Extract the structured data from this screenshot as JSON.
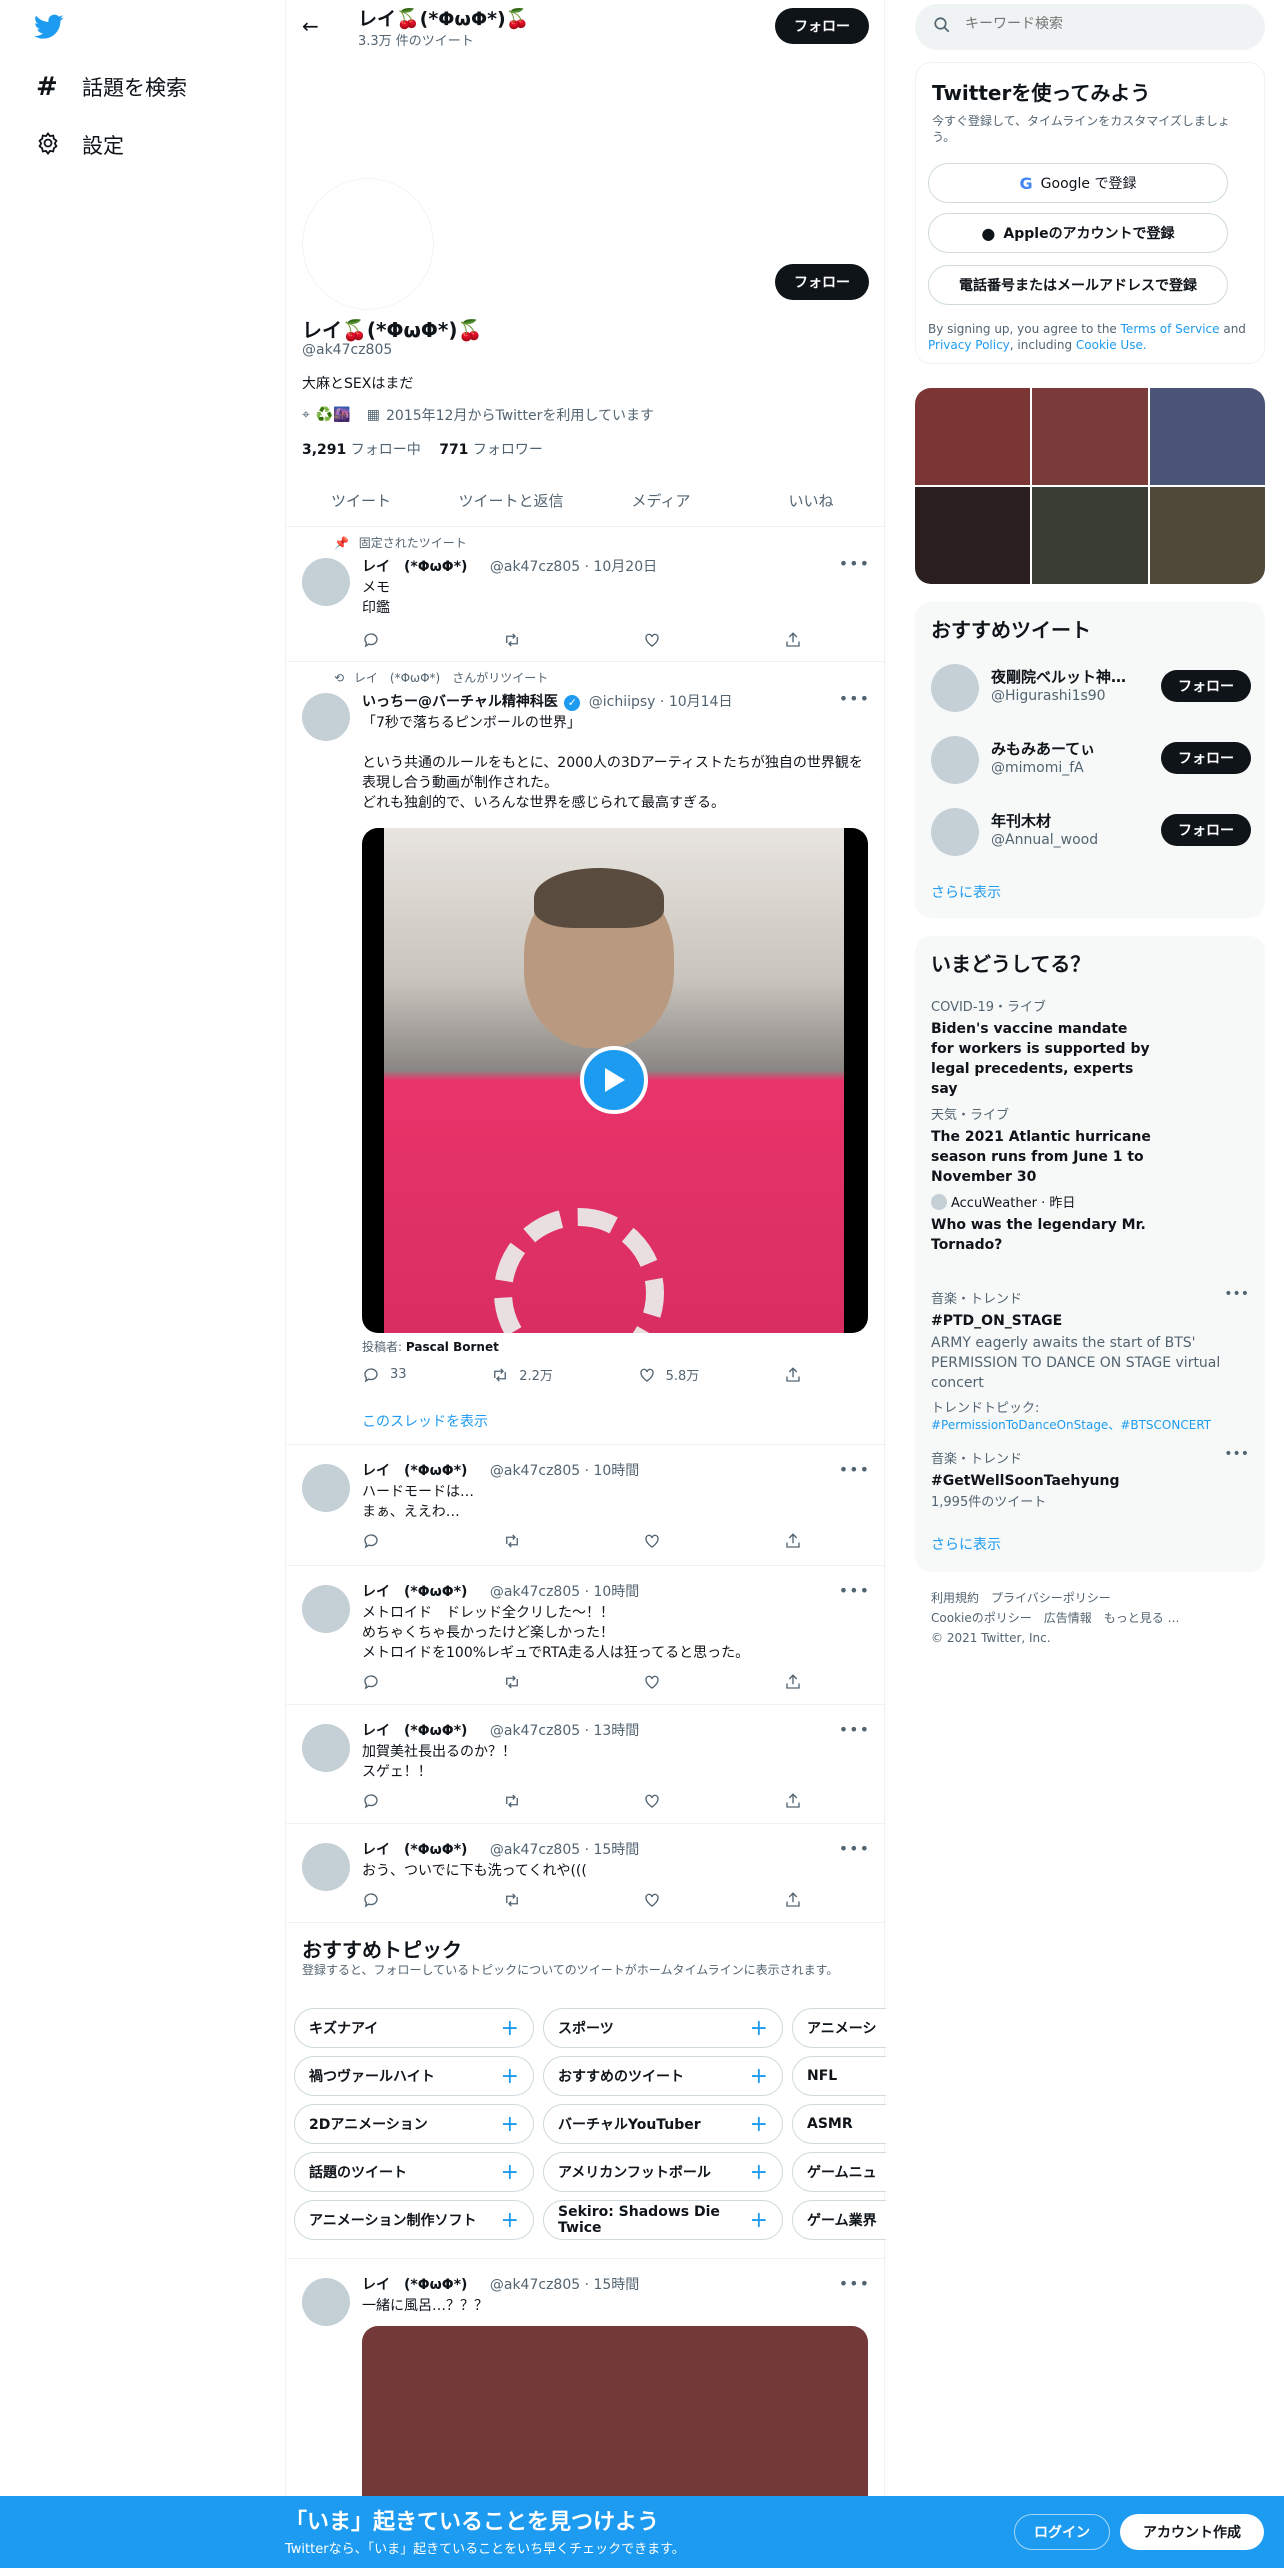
{
  "nav": {
    "explore_label": "話題を検索",
    "settings_label": "設定"
  },
  "header": {
    "name": "レイ🍒(*ΦωΦ*)🍒",
    "tweet_count": "3.3万 件のツイート",
    "follow_label": "フォロー"
  },
  "profile": {
    "name": "レイ🍒(*ΦωΦ*)🍒",
    "handle": "@ak47cz805",
    "bio": "大麻とSEXはまだ",
    "location": "♻️🌆",
    "joined": "2015年12月からTwitterを利用しています",
    "following_count": "3,291",
    "following_label": "フォロー中",
    "followers_count": "771",
    "followers_label": "フォロワー",
    "follow_label": "フォロー"
  },
  "tabs": [
    "ツイート",
    "ツイートと返信",
    "メディア",
    "いいね"
  ],
  "pinned": {
    "label": "固定されたツイート",
    "name": "レイ　(*ΦωΦ*)",
    "handle_time": "@ak47cz805 · 10月20日",
    "text": "メモ\n印鑑"
  },
  "retweet": {
    "label": "レイ　(*ΦωΦ*)　さんがリツイート",
    "name": "いっちー@バーチャル精神科医",
    "handle_time": "@ichiipsy · 10月14日",
    "text": "「7秒で落ちるピンボールの世界」\n\nという共通のルールをもとに、2000人の3Dアーティストたちが独自の世界観を表現し合う動画が制作された。\nどれも独創的で、いろんな世界を感じられて最高すぎる。",
    "poster_label": "投稿者:",
    "poster_name": "Pascal Bornet",
    "replies": "33",
    "retweets": "2.2万",
    "likes": "5.8万",
    "thread_link": "このスレッドを表示"
  },
  "tweets": [
    {
      "name": "レイ　(*ΦωΦ*)",
      "handle_time": "@ak47cz805 · 10時間",
      "text": "ハードモードは…\nまぁ、ええわ…"
    },
    {
      "name": "レイ　(*ΦωΦ*)",
      "handle_time": "@ak47cz805 · 10時間",
      "text": "メトロイド　ドレッド全クリした〜！！\nめちゃくちゃ長かったけど楽しかった！\nメトロイドを100%レギュでRTA走る人は狂ってると思った。"
    },
    {
      "name": "レイ　(*ΦωΦ*)",
      "handle_time": "@ak47cz805 · 13時間",
      "text": "加賀美社長出るのか？！\nスゲェ！！"
    },
    {
      "name": "レイ　(*ΦωΦ*)",
      "handle_time": "@ak47cz805 · 15時間",
      "text": "おう、ついでに下も洗ってくれや((("
    }
  ],
  "topics": {
    "title": "おすすめトピック",
    "subtitle": "登録すると、フォローしているトピックについてのツイートがホームタイムラインに表示されます。",
    "rows": [
      [
        "キズナアイ",
        "スポーツ",
        "アニメーシ"
      ],
      [
        "禍つヴァールハイト",
        "おすすめのツイート",
        "NFL"
      ],
      [
        "2Dアニメーション",
        "バーチャルYouTuber",
        "ASMR"
      ],
      [
        "話題のツイート",
        "アメリカンフットボール",
        "ゲームニュ"
      ],
      [
        "アニメーション制作ソフト",
        "Sekiro: Shadows Die Twice",
        "ゲーム業界"
      ]
    ]
  },
  "last_tweet": {
    "name": "レイ　(*ΦωΦ*)",
    "handle_time": "@ak47cz805 · 15時間",
    "text": "一緒に風呂…？？？"
  },
  "search": {
    "placeholder": "キーワード検索"
  },
  "signup": {
    "title": "Twitterを使ってみよう",
    "subtitle": "今すぐ登録して、タイムラインをカスタマイズしましょう。",
    "google": "Google で登録",
    "apple": "Appleのアカウントで登録",
    "phone": "電話番号またはメールアドレスで登録",
    "terms_1": "By signing up, you agree to the ",
    "terms_link1": "Terms of Service",
    "terms_2": " and ",
    "terms_link2": "Privacy Policy",
    "terms_3": ", including ",
    "terms_link3": "Cookie Use."
  },
  "media_grid_colors": [
    "#7b3535",
    "#7a3a3a",
    "#4a5577",
    "#2a1e1e",
    "#3a3d33",
    "#50493a"
  ],
  "recommended": {
    "title": "おすすめツイート",
    "users": [
      {
        "name": "夜剛院ベルット神…",
        "handle": "@Higurashi1s90"
      },
      {
        "name": "みもみあーてぃ",
        "handle": "@mimomi_fA"
      },
      {
        "name": "年刊木材",
        "handle": "@Annual_wood"
      }
    ],
    "follow_label": "フォロー",
    "more": "さらに表示"
  },
  "trends": {
    "title": "いまどうしてる？",
    "items": [
      {
        "meta": "COVID-19・ライブ",
        "title": "Biden's vaccine mandate for workers is supported by legal precedents, experts say"
      },
      {
        "meta": "天気・ライブ",
        "title": "The 2021 Atlantic hurricane season runs from June 1 to November 30"
      },
      {
        "meta": "AccuWeather · 昨日",
        "title": "Who was the legendary Mr. Tornado?"
      },
      {
        "meta": "音楽・トレンド",
        "title": "#PTD_ON_STAGE",
        "desc": "ARMY eagerly awaits the start of BTS' PERMISSION TO DANCE ON STAGE virtual concert",
        "topics_label": "トレンドトピック:",
        "topics": "#PermissionToDanceOnStage、#BTSCONCERT"
      },
      {
        "meta": "音楽・トレンド",
        "title": "#GetWellSoonTaehyung",
        "desc": "1,995件のツイート"
      }
    ],
    "more": "さらに表示"
  },
  "footer": {
    "line1": "利用規約　プライバシーポリシー",
    "line2": "Cookieのポリシー　広告情報　もっと見る …",
    "line3": "© 2021 Twitter, Inc."
  },
  "bottom": {
    "title": "「いま」起きていることを見つけよう",
    "subtitle": "Twitterなら、「いま」起きていることをいち早くチェックできます。",
    "login": "ログイン",
    "signup": "アカウント作成"
  }
}
